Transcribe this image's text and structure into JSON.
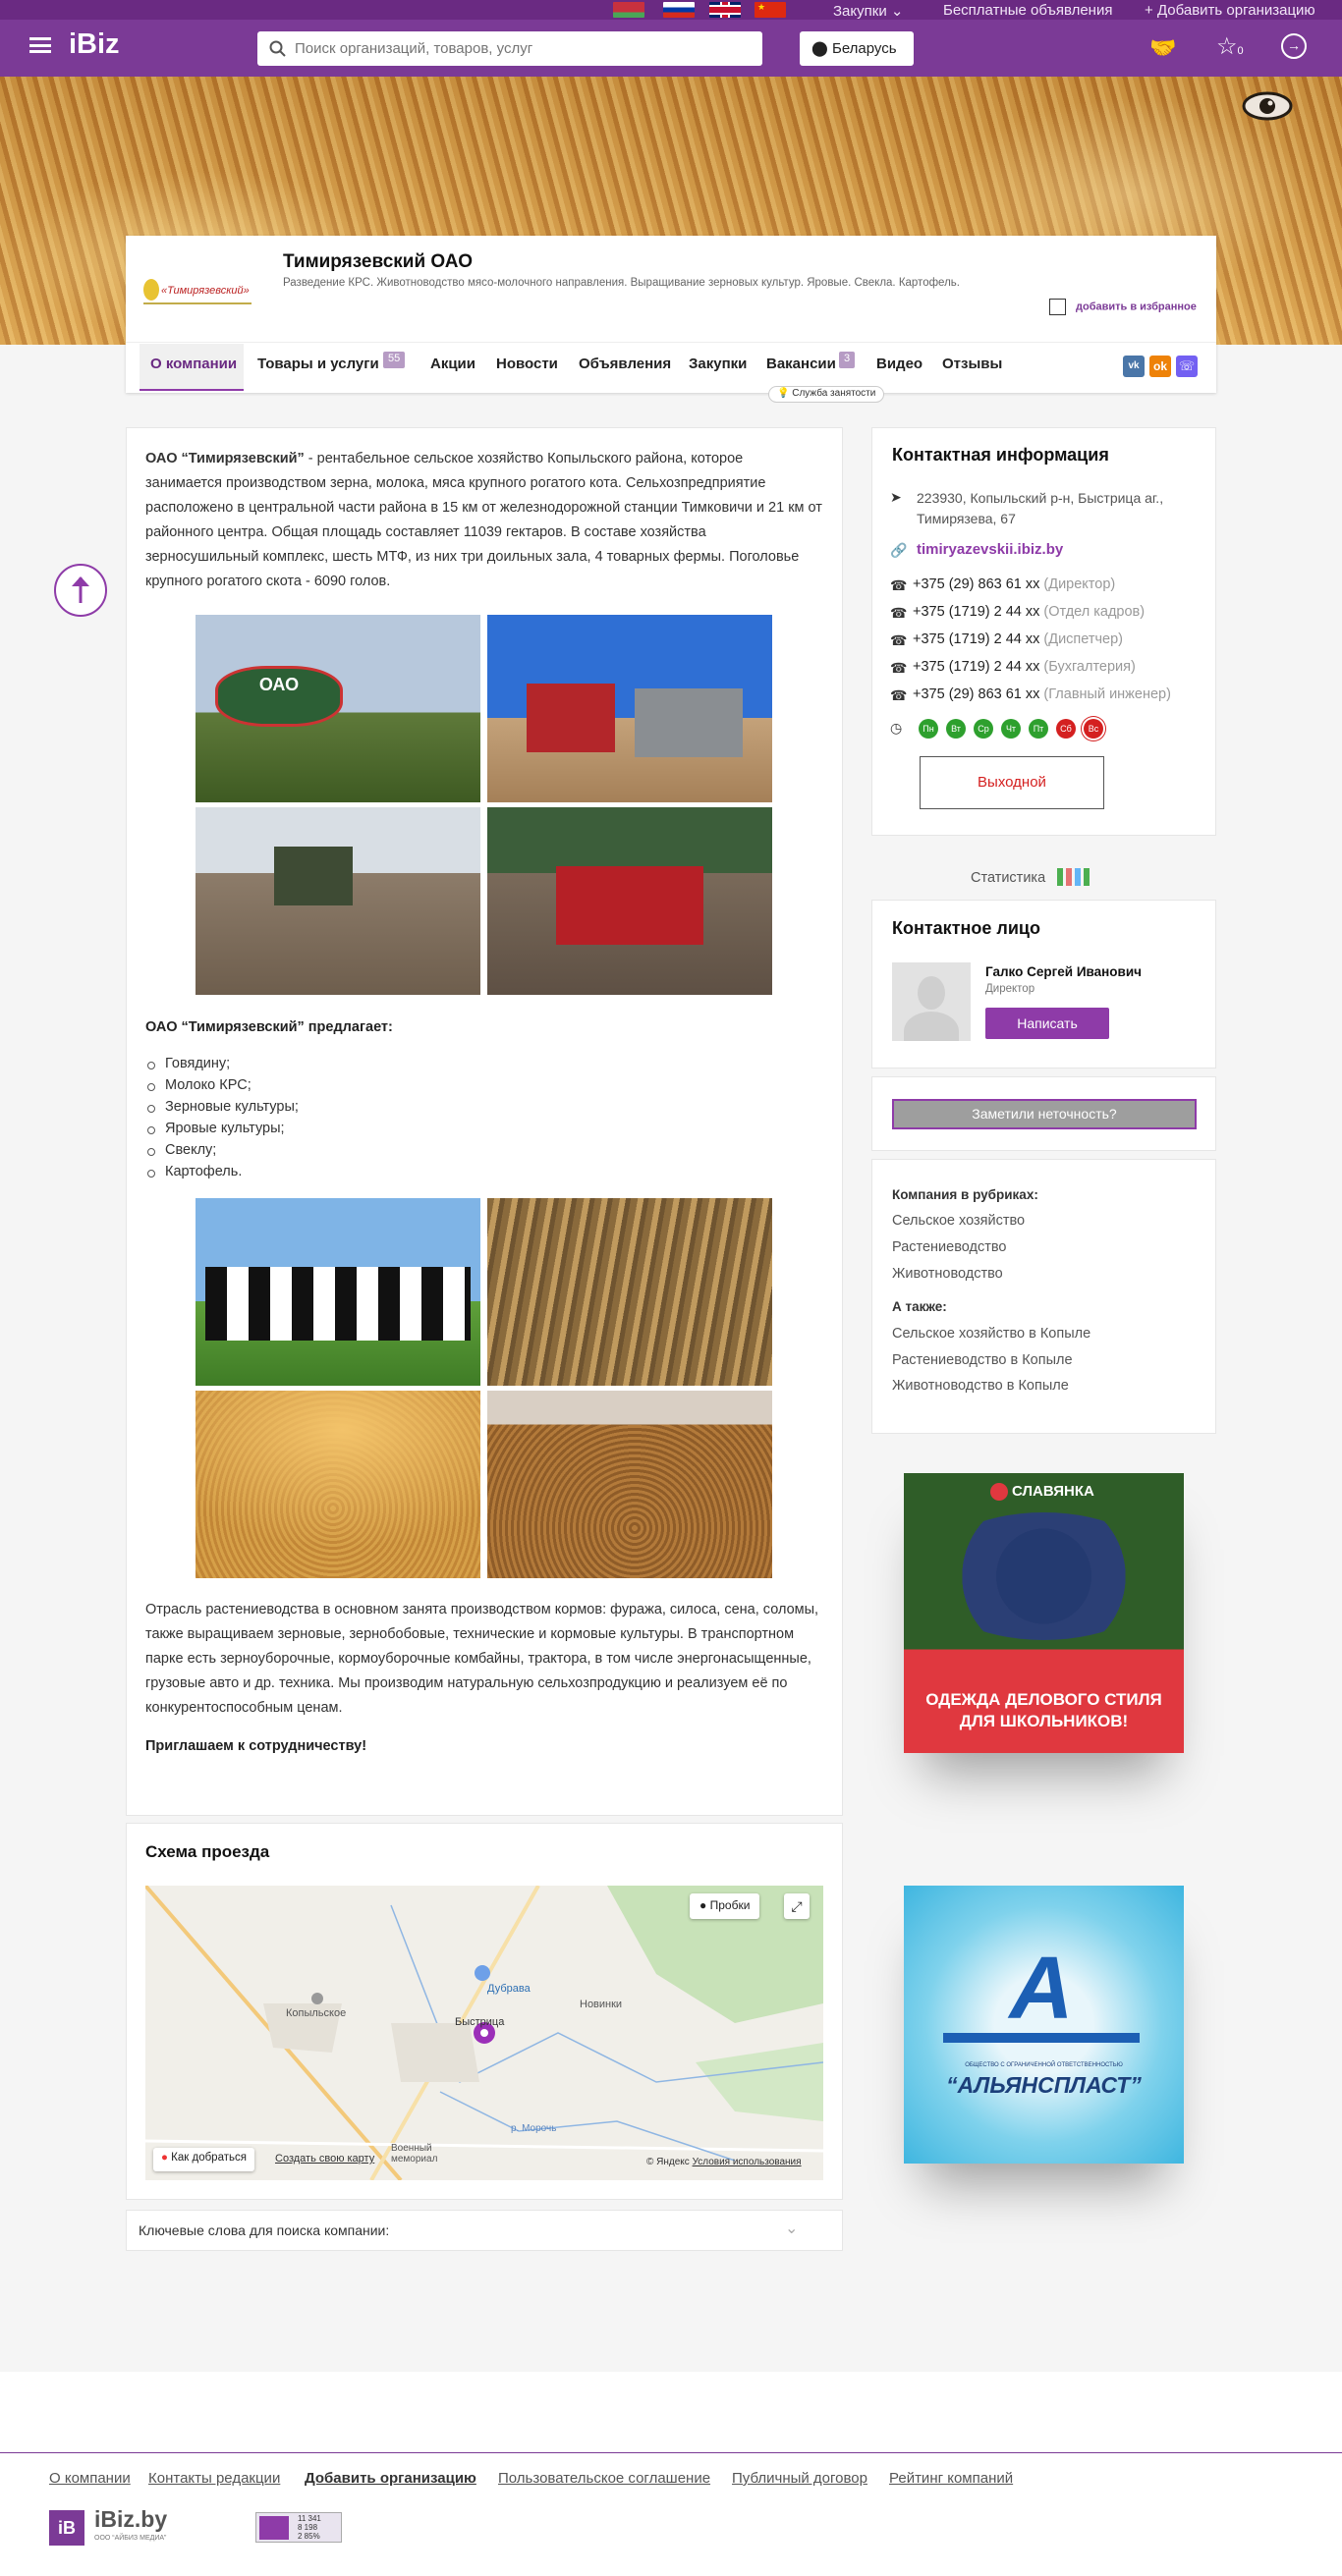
{
  "header": {
    "logo": "iBiz",
    "search_placeholder": "Поиск организаций, товаров, услуг",
    "region": "Беларусь",
    "fav_count": "0"
  },
  "topbar": {
    "purchases": "Закупки",
    "free_ads": "Бесплатные объявления",
    "add_org": "Добавить организацию"
  },
  "company": {
    "name": "Тимирязевский ОАО",
    "tagline": "Разведение КРС. Животноводство мясо-молочного направления. Выращивание зерновых культур. Яровые. Свекла. Картофель.",
    "favorite_label": "добавить в избранное",
    "logo_text": "«Тимирязевский»"
  },
  "tabs": [
    {
      "label": "О компании"
    },
    {
      "label": "Товары и услуги",
      "badge": "55"
    },
    {
      "label": "Акции"
    },
    {
      "label": "Новости"
    },
    {
      "label": "Объявления"
    },
    {
      "label": "Закупки"
    },
    {
      "label": "Вакансии",
      "badge": "3"
    },
    {
      "label": "Видео"
    },
    {
      "label": "Отзывы"
    }
  ],
  "employment_service": "Служба занятости",
  "about": {
    "intro_bold": "ОАО “Тимирязевский”",
    "intro_text": " - рентабельное сельское хозяйство Копыльского района, которое занимается производством зерна, молока, мяса крупного рогатого кота. Сельхозпредприятие расположено в центральной части района в 15 км от железнодорожной станции Тимковичи и 21 км от районного центра. Общая площадь составляет 11039 гектаров. В составе хозяйства зерносушильный комплекс, шесть МТФ, из них три доильных зала, 4 товарных фермы. Поголовье крупного рогатого скота - 6090 голов.",
    "offers_title": "ОАО “Тимирязевский” предлагает:",
    "offers": [
      "Говядину;",
      "Молоко КРС;",
      "Зерновые культуры;",
      "Яровые культуры;",
      "Свеклу;",
      "Картофель."
    ],
    "para2": "Отрасль растениеводства в основном занята производством кормов: фуража, силоса, сена, соломы, также выращиваем зерновые, зернобобовые, технические и кормовые культуры. В транспортном парке есть зерноуборочные, кормоуборочные комбайны, трактора, в том числе энергонасыщенные, грузовые авто и др. техника. Мы производим натуральную сельхозпродукцию и реализуем её по конкурентоспособным ценам.",
    "invite": "Приглашаем к сотрудничеству!",
    "sign_text": "ОАО"
  },
  "map": {
    "title": "Схема проезда",
    "traffic": "Пробки",
    "route": "Как добраться",
    "create": "Создать свою карту",
    "copyright": "© Яндекс",
    "terms": "Условия использования",
    "places": [
      "Дубрава",
      "Копыльское",
      "Быстрица",
      "Новинки",
      "Военный мемориал",
      "р. Морочь"
    ]
  },
  "keywords": {
    "label": "Ключевые слова для поиска компании:"
  },
  "contacts": {
    "title": "Контактная информация",
    "address": "223930, Копыльский р-н, Быстрица аг., Тимирязева, 67",
    "site": "timiryazevskii.ibiz.by",
    "phones": [
      {
        "number": "+375 (29) 863 61 xx",
        "role": "(Директор)"
      },
      {
        "number": "+375 (1719) 2 44 xx",
        "role": "(Отдел кадров)"
      },
      {
        "number": "+375 (1719) 2 44 xx",
        "role": "(Диспетчер)"
      },
      {
        "number": "+375 (1719) 2 44 xx",
        "role": "(Бухгалтерия)"
      },
      {
        "number": "+375 (29) 863 61 xx",
        "role": "(Главный инженер)"
      }
    ],
    "days": [
      "Пн",
      "Вт",
      "Ср",
      "Чт",
      "Пт",
      "Сб",
      "Вс"
    ],
    "day_off": "Выходной"
  },
  "stats": "Статистика",
  "person": {
    "title": "Контактное лицо",
    "name": "Галко Сергей Иванович",
    "role": "Директор",
    "write": "Написать"
  },
  "report": "Заметили неточность?",
  "rubrics": {
    "title": "Компания в рубриках:",
    "items": [
      "Сельское хозяйство",
      "Растениеводство",
      "Животноводство"
    ],
    "also_title": "А также:",
    "also": [
      "Сельское хозяйство в Копыле",
      "Растениеводство в Копыле",
      "Животноводство в Копыле"
    ]
  },
  "ads": {
    "ad1_brand": "СЛАВЯНКА",
    "ad1_text": "ОДЕЖДА ДЕЛОВОГО СТИЛЯ ДЛЯ ШКОЛЬНИКОВ!",
    "ad2_text": "“АЛЬЯНСПЛАСТ”",
    "ad2_small": "ОБЩЕСТВО С ОГРАНИЧЕННОЙ ОТВЕТСТВЕННОСТЬЮ"
  },
  "footer": {
    "links": [
      "О компании",
      "Контакты редакции",
      "Добавить организацию",
      "Пользовательское соглашение",
      "Публичный договор",
      "Рейтинг компаний"
    ],
    "brand": "iBiz.by",
    "brand_sub": "ООО “АЙБИЗ МЕДИА”",
    "counter": [
      "11 341",
      "8 198",
      "2 85%"
    ]
  },
  "colors": {
    "brand": "#7b3a96",
    "accent": "#8e3ba8",
    "green": "#2ea02e",
    "red": "#d42020"
  }
}
